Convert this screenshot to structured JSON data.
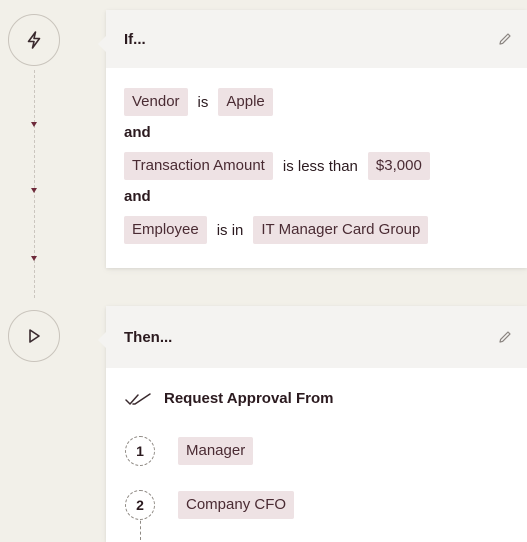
{
  "trigger_card": {
    "title": "If...",
    "conditions": [
      {
        "field": "Vendor",
        "operator": "is",
        "value": "Apple"
      },
      {
        "field": "Transaction Amount",
        "operator": "is less than",
        "value": "$3,000"
      },
      {
        "field": "Employee",
        "operator": "is in",
        "value": "IT Manager Card Group"
      }
    ],
    "connector": "and"
  },
  "action_card": {
    "title": "Then...",
    "action_label": "Request Approval From",
    "approvers": [
      {
        "number": "1",
        "name": "Manager"
      },
      {
        "number": "2",
        "name": "Company CFO"
      }
    ]
  },
  "icons": {
    "trigger": "lightning-icon",
    "action": "play-icon",
    "edit": "pencil-icon",
    "approval": "double-check-icon"
  },
  "colors": {
    "background": "#f2f0e9",
    "chip_bg": "#eee2e4",
    "accent": "#6e2a3a"
  }
}
